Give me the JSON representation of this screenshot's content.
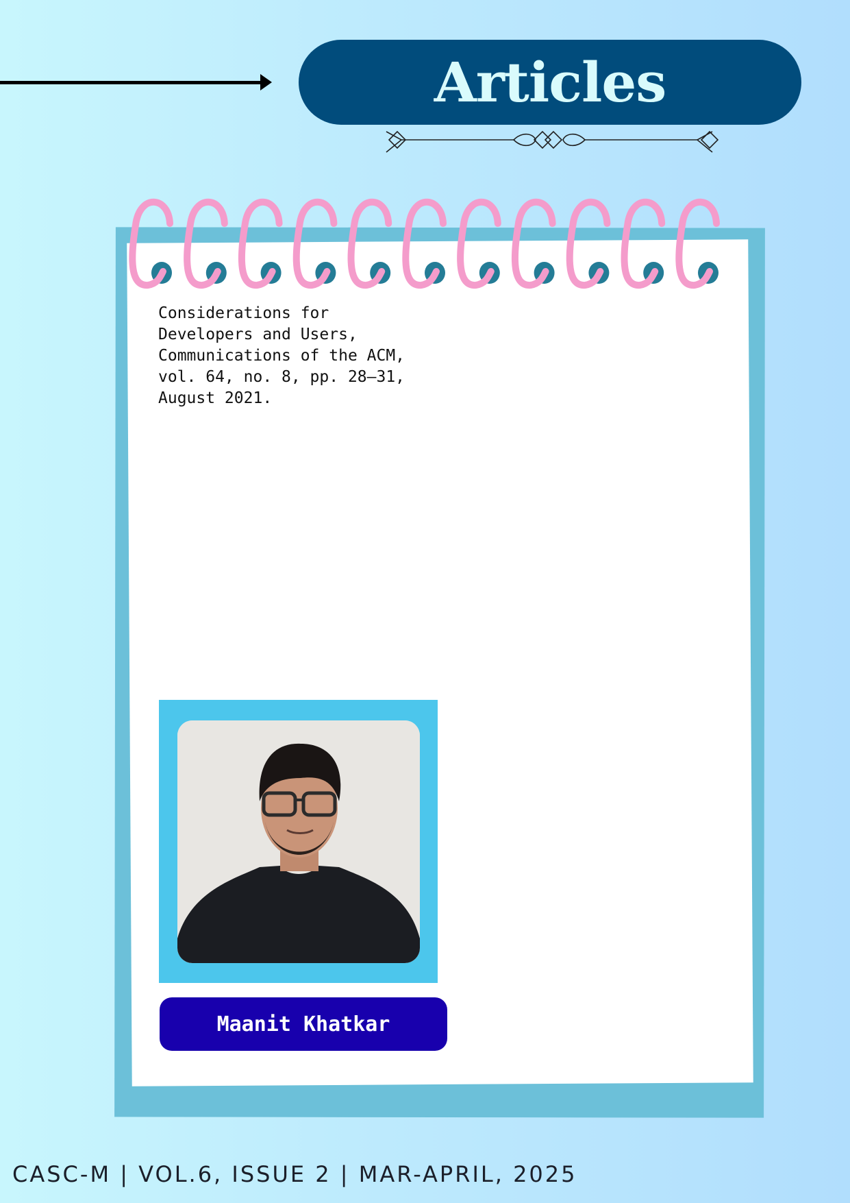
{
  "header": {
    "title": "Articles"
  },
  "article": {
    "citation": "Considerations for\nDevelopers and Users,\nCommunications of the ACM,\nvol. 64, no. 8, pp. 28–31,\nAugust 2021."
  },
  "author": {
    "name": "Maanit Khatkar"
  },
  "footer": {
    "text": "CASC-M | VOL.6, ISSUE 2 | MAR-APRIL, 2025"
  },
  "colors": {
    "title_pill": "#014c7c",
    "title_text": "#d9fbfc",
    "frame": "#6cc0d9",
    "rings": "#f49ccb",
    "holes": "#247c96",
    "photo_frame": "#4cc6ec",
    "name_pill": "#1800ad"
  },
  "icons": [
    "arrow-right-icon",
    "decorative-divider-icon",
    "spiral-binding-icon"
  ]
}
